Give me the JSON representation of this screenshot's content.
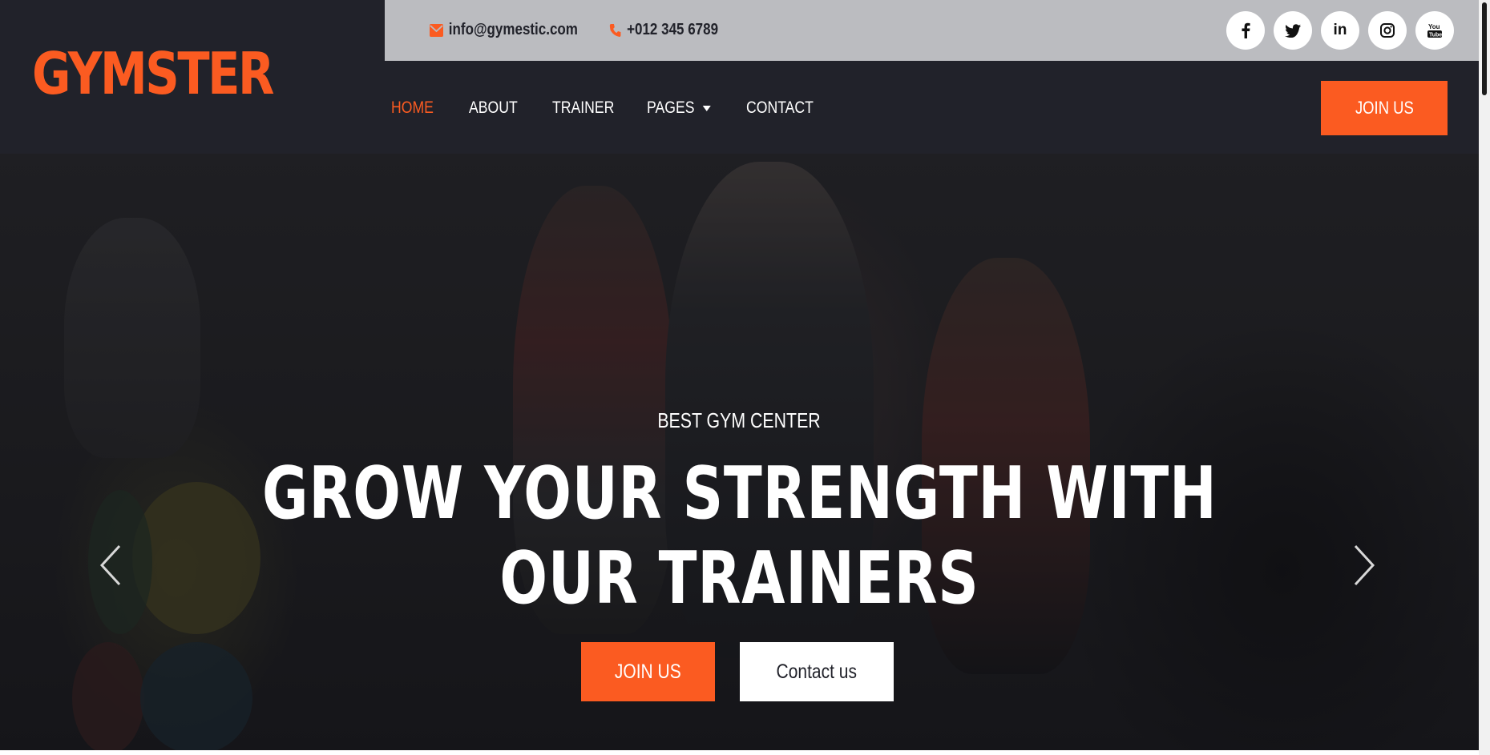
{
  "brand": {
    "logo_text": "GYMSTER"
  },
  "topbar": {
    "email": "info@gymestic.com",
    "phone": "+012 345 6789",
    "email_icon": "envelope-icon",
    "phone_icon": "phone-icon",
    "social": [
      {
        "name": "facebook-icon",
        "glyph": "f"
      },
      {
        "name": "twitter-icon",
        "glyph": "t"
      },
      {
        "name": "linkedin-icon",
        "glyph": "in"
      },
      {
        "name": "instagram-icon",
        "glyph": "ig"
      },
      {
        "name": "youtube-icon",
        "glyph": "yt"
      }
    ]
  },
  "nav": {
    "items": [
      {
        "label": "HOME",
        "active": true
      },
      {
        "label": "ABOUT",
        "active": false
      },
      {
        "label": "TRAINER",
        "active": false
      },
      {
        "label": "PAGES",
        "active": false,
        "dropdown": true
      },
      {
        "label": "CONTACT",
        "active": false
      }
    ],
    "join_label": "JOIN US"
  },
  "hero": {
    "subtitle": "BEST GYM CENTER",
    "title_line1": "GROW YOUR STRENGTH WITH",
    "title_line2": "OUR TRAINERS",
    "primary_button": "JOIN US",
    "secondary_button": "Contact us",
    "prev_icon": "chevron-left-icon",
    "next_icon": "chevron-right-icon"
  },
  "colors": {
    "accent": "#fb5b21",
    "dark": "#21222a",
    "topbar": "#bbbcc0",
    "white": "#ffffff"
  }
}
